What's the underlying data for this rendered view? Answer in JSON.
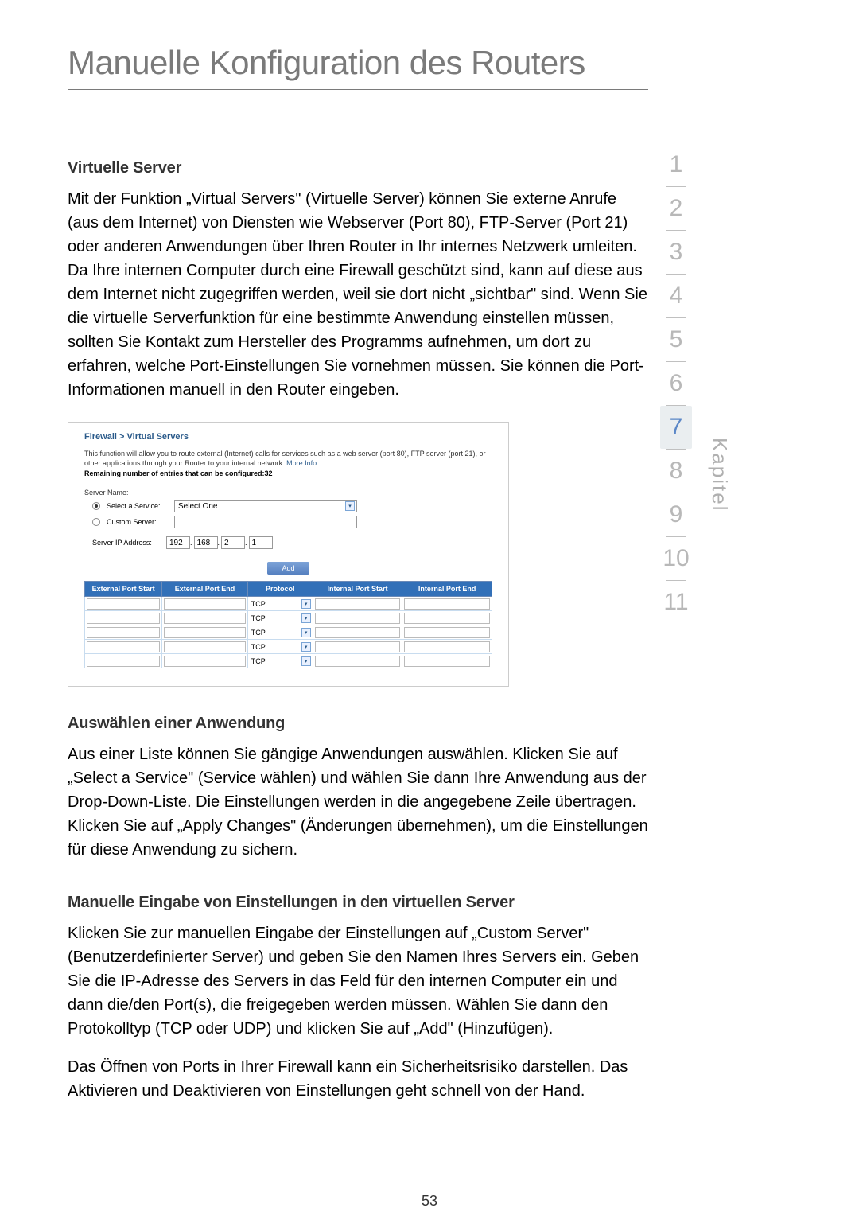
{
  "page_title": "Manuelle Konfiguration des Routers",
  "page_number": "53",
  "kapitel_label": "Kapitel",
  "chapters": [
    "1",
    "2",
    "3",
    "4",
    "5",
    "6",
    "7",
    "8",
    "9",
    "10",
    "11"
  ],
  "active_chapter": "7",
  "section1": {
    "head": "Virtuelle Server",
    "body": "Mit der Funktion „Virtual Servers\" (Virtuelle Server) können Sie externe Anrufe (aus dem Internet) von Diensten wie Webserver (Port 80), FTP-Server (Port 21) oder anderen Anwendungen über Ihren Router in Ihr internes Netzwerk umleiten. Da Ihre internen Computer durch eine Firewall geschützt sind, kann auf diese aus dem Internet nicht zugegriffen werden, weil sie dort nicht „sichtbar\" sind. Wenn Sie die virtuelle Serverfunktion für eine bestimmte Anwendung einstellen müssen, sollten Sie Kontakt zum Hersteller des Programms aufnehmen, um dort zu erfahren, welche Port-Einstellungen Sie vornehmen müssen. Sie können die Port-Informationen manuell in den Router eingeben."
  },
  "router_ui": {
    "breadcrumb": "Firewall > Virtual Servers",
    "desc": "This function will allow you to route external (Internet) calls for services such as a web server (port 80), FTP server (port 21), or other applications through your Router to your internal network.",
    "more": "More Info",
    "remaining": "Remaining number of entries that can be configured:32",
    "server_name_label": "Server Name:",
    "select_service_label": "Select a Service:",
    "select_service_value": "Select One",
    "custom_server_label": "Custom Server:",
    "ip_label": "Server IP Address:",
    "ip": [
      "192",
      "168",
      "2",
      "1"
    ],
    "add_label": "Add",
    "table_headers": [
      "External Port Start",
      "External Port End",
      "Protocol",
      "Internal Port Start",
      "Internal Port End"
    ],
    "proto_value": "TCP",
    "row_count": 5
  },
  "section2": {
    "head": "Auswählen einer Anwendung",
    "body": "Aus einer Liste können Sie gängige Anwendungen auswählen. Klicken Sie auf „Select a Service\" (Service wählen) und wählen Sie dann Ihre Anwendung aus der Drop-Down-Liste. Die Einstellungen werden in die angegebene Zeile übertragen. Klicken Sie auf „Apply Changes\" (Änderungen übernehmen), um die Einstellungen für diese Anwendung zu sichern."
  },
  "section3": {
    "head": "Manuelle Eingabe von Einstellungen in den virtuellen Server",
    "body1": "Klicken Sie zur manuellen Eingabe der Einstellungen auf  „Custom Server\" (Benutzerdefinierter Server) und geben Sie den Namen Ihres Servers ein. Geben Sie die IP-Adresse des Servers in das Feld für den internen Computer ein und dann die/den Port(s), die freigegeben werden müssen. Wählen Sie dann den Protokolltyp (TCP oder UDP) und klicken Sie auf „Add\" (Hinzufügen).",
    "body2": "Das Öffnen von Ports in Ihrer Firewall kann ein Sicherheitsrisiko darstellen. Das Aktivieren und Deaktivieren von Einstellungen geht schnell von der Hand."
  }
}
